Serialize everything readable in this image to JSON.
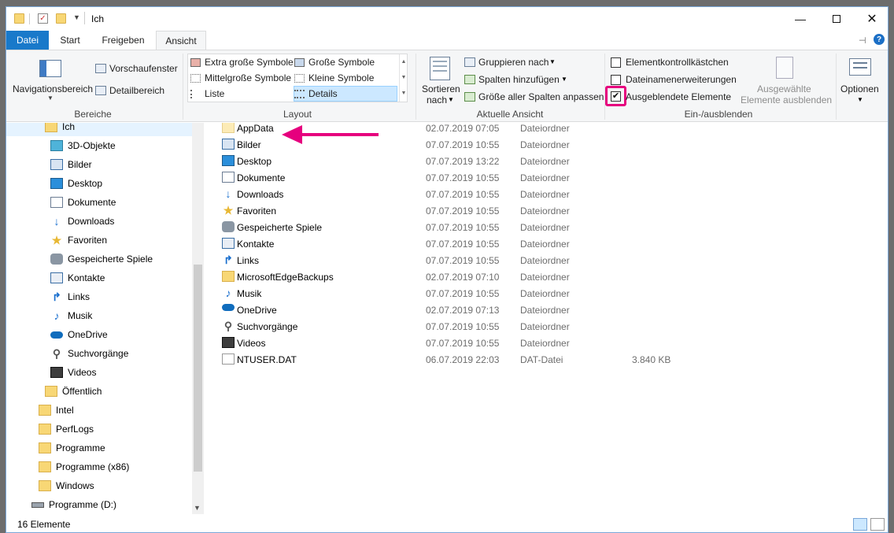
{
  "title": {
    "text": "Ich"
  },
  "tabs": [
    "Datei",
    "Start",
    "Freigeben",
    "Ansicht"
  ],
  "ribbon": {
    "bereiche": {
      "label": "Bereiche",
      "navigationsbereich": "Navigationsbereich",
      "vorschaufenster": "Vorschaufenster",
      "detailbereich": "Detailbereich"
    },
    "layout": {
      "label": "Layout",
      "items": [
        "Extra große Symbole",
        "Große Symbole",
        "Mittelgroße Symbole",
        "Kleine Symbole",
        "Liste",
        "Details"
      ],
      "selected": "Details"
    },
    "aktuelle_ansicht": {
      "label": "Aktuelle Ansicht",
      "sortieren_line1": "Sortieren",
      "sortieren_line2": "nach",
      "gruppieren": "Gruppieren nach",
      "spalten": "Spalten hinzufügen",
      "groesse": "Größe aller Spalten anpassen"
    },
    "ein_ausblenden": {
      "label": "Ein-/ausblenden",
      "elementkontroll": "Elementkontrollkästchen",
      "dateinamen": "Dateinamenerweiterungen",
      "ausgeblendete": "Ausgeblendete Elemente",
      "ausgewaehlte_line1": "Ausgewählte",
      "ausgewaehlte_line2": "Elemente ausblenden"
    },
    "optionen": "Optionen"
  },
  "checkboxes": {
    "elementkontroll": false,
    "dateinamen": false,
    "ausgeblendete": true
  },
  "nav_items": [
    {
      "label": "Ich",
      "icon": "folder-icon",
      "indent": 1
    },
    {
      "label": "3D-Objekte",
      "icon": "3d-objects-icon",
      "indent": 2
    },
    {
      "label": "Bilder",
      "icon": "pictures-icon",
      "indent": 2
    },
    {
      "label": "Desktop",
      "icon": "desktop-icon",
      "indent": 2
    },
    {
      "label": "Dokumente",
      "icon": "documents-icon",
      "indent": 2
    },
    {
      "label": "Downloads",
      "icon": "downloads-icon",
      "indent": 2
    },
    {
      "label": "Favoriten",
      "icon": "star-icon",
      "indent": 2
    },
    {
      "label": "Gespeicherte Spiele",
      "icon": "saved-games-icon",
      "indent": 2
    },
    {
      "label": "Kontakte",
      "icon": "contacts-icon",
      "indent": 2
    },
    {
      "label": "Links",
      "icon": "links-icon",
      "indent": 2
    },
    {
      "label": "Musik",
      "icon": "music-icon",
      "indent": 2
    },
    {
      "label": "OneDrive",
      "icon": "onedrive-icon",
      "indent": 2
    },
    {
      "label": "Suchvorgänge",
      "icon": "search-icon",
      "indent": 2
    },
    {
      "label": "Videos",
      "icon": "videos-icon",
      "indent": 2
    },
    {
      "label": "Öffentlich",
      "icon": "folder-icon",
      "indent": 1
    },
    {
      "label": "Intel",
      "icon": "folder-icon",
      "indent": 0
    },
    {
      "label": "PerfLogs",
      "icon": "folder-icon",
      "indent": 0
    },
    {
      "label": "Programme",
      "icon": "folder-icon",
      "indent": 0
    },
    {
      "label": "Programme (x86)",
      "icon": "folder-icon",
      "indent": 0
    },
    {
      "label": "Windows",
      "icon": "folder-icon",
      "indent": 0
    },
    {
      "label": "Programme (D:)",
      "icon": "drive-icon",
      "indent": -1
    }
  ],
  "files": [
    {
      "name": "AppData",
      "date": "02.07.2019 07:05",
      "type": "Dateiordner",
      "size": "",
      "icon": "folder-light-icon"
    },
    {
      "name": "Bilder",
      "date": "07.07.2019 10:55",
      "type": "Dateiordner",
      "size": "",
      "icon": "pictures-icon"
    },
    {
      "name": "Desktop",
      "date": "07.07.2019 13:22",
      "type": "Dateiordner",
      "size": "",
      "icon": "desktop-icon"
    },
    {
      "name": "Dokumente",
      "date": "07.07.2019 10:55",
      "type": "Dateiordner",
      "size": "",
      "icon": "documents-icon"
    },
    {
      "name": "Downloads",
      "date": "07.07.2019 10:55",
      "type": "Dateiordner",
      "size": "",
      "icon": "downloads-icon"
    },
    {
      "name": "Favoriten",
      "date": "07.07.2019 10:55",
      "type": "Dateiordner",
      "size": "",
      "icon": "star-icon"
    },
    {
      "name": "Gespeicherte Spiele",
      "date": "07.07.2019 10:55",
      "type": "Dateiordner",
      "size": "",
      "icon": "saved-games-icon"
    },
    {
      "name": "Kontakte",
      "date": "07.07.2019 10:55",
      "type": "Dateiordner",
      "size": "",
      "icon": "contacts-icon"
    },
    {
      "name": "Links",
      "date": "07.07.2019 10:55",
      "type": "Dateiordner",
      "size": "",
      "icon": "links-icon"
    },
    {
      "name": "MicrosoftEdgeBackups",
      "date": "02.07.2019 07:10",
      "type": "Dateiordner",
      "size": "",
      "icon": "folder-icon"
    },
    {
      "name": "Musik",
      "date": "07.07.2019 10:55",
      "type": "Dateiordner",
      "size": "",
      "icon": "music-icon"
    },
    {
      "name": "OneDrive",
      "date": "02.07.2019 07:13",
      "type": "Dateiordner",
      "size": "",
      "icon": "onedrive-icon"
    },
    {
      "name": "Suchvorgänge",
      "date": "07.07.2019 10:55",
      "type": "Dateiordner",
      "size": "",
      "icon": "search-icon"
    },
    {
      "name": "Videos",
      "date": "07.07.2019 10:55",
      "type": "Dateiordner",
      "size": "",
      "icon": "videos-icon"
    },
    {
      "name": "NTUSER.DAT",
      "date": "06.07.2019 22:03",
      "type": "DAT-Datei",
      "size": "3.840 KB",
      "icon": "file-icon"
    }
  ],
  "status": {
    "count": "16 Elemente"
  },
  "colors": {
    "accent": "#1979ca",
    "highlight": "#e6007e",
    "ribbon_bg": "#f5f6f7",
    "selection": "#cce8ff"
  }
}
